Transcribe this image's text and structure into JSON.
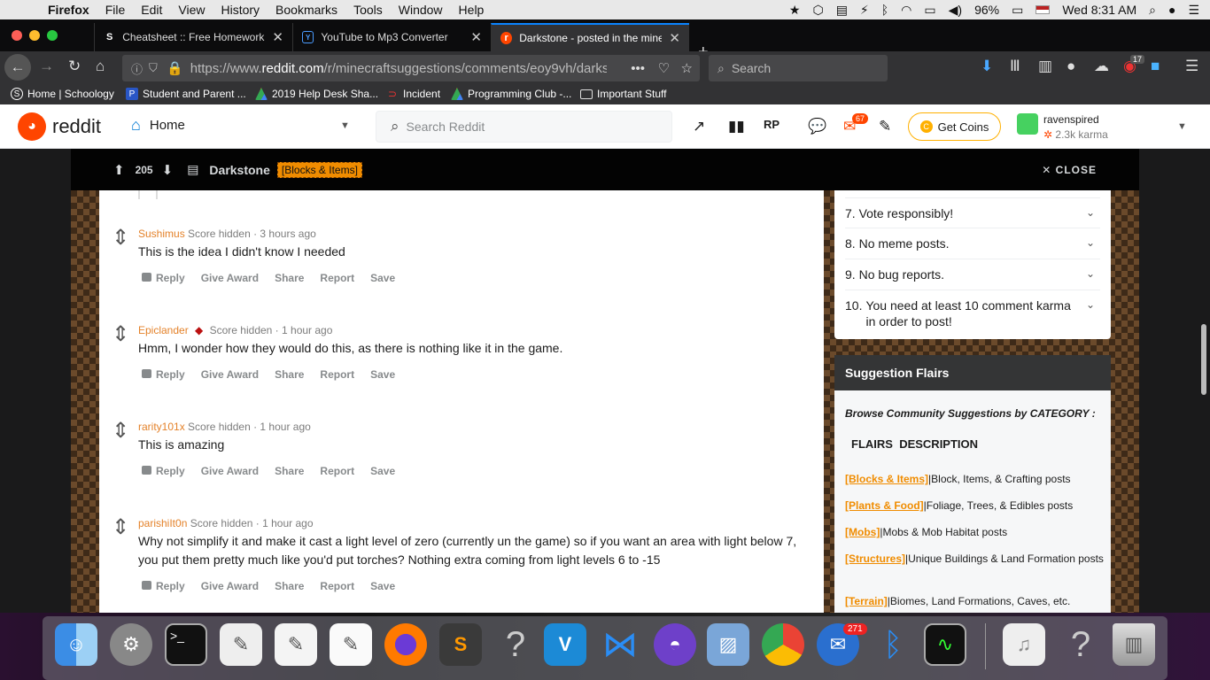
{
  "menubar": {
    "app": "Firefox",
    "items": [
      "File",
      "Edit",
      "View",
      "History",
      "Bookmarks",
      "Tools",
      "Window",
      "Help"
    ],
    "battery": "96%",
    "clock": "Wed 8:31 AM"
  },
  "tabs": [
    {
      "label": "Cheatsheet :: Free Homework H",
      "favicon": "S"
    },
    {
      "label": "YouTube to Mp3 Converter",
      "favicon": "Y"
    },
    {
      "label": "Darkstone - posted in the minec",
      "favicon": "r"
    }
  ],
  "nav": {
    "url_prefix": "https://www.",
    "url_domain": "reddit.com",
    "url_path": "/r/minecraftsuggestions/comments/eoy9vh/darks",
    "search_placeholder": "Search",
    "addon_badge": "17"
  },
  "bookmarks": [
    {
      "label": "Home | Schoology",
      "icon": "S"
    },
    {
      "label": "Student and Parent ...",
      "icon": "P"
    },
    {
      "label": "2019 Help Desk Sha...",
      "icon": "drive"
    },
    {
      "label": "Incident",
      "icon": "sn"
    },
    {
      "label": "Programming Club -...",
      "icon": "drive"
    },
    {
      "label": "Important Stuff",
      "icon": "folder"
    }
  ],
  "reddit_header": {
    "logo_text": "reddit",
    "home_label": "Home",
    "search_placeholder": "Search Reddit",
    "mail_badge": "67",
    "coins_label": "Get Coins",
    "username": "ravenspired",
    "karma": "2.3k karma"
  },
  "post_bar": {
    "score": "205",
    "title": "Darkstone",
    "flair": "[Blocks & Items]",
    "close_label": "CLOSE"
  },
  "comments": [
    {
      "author": "Sushimus",
      "score": "Score hidden",
      "time": "3 hours ago",
      "body": "This is the idea I didn't know I needed"
    },
    {
      "author": "Epiclander",
      "score": "Score hidden",
      "time": "1 hour ago",
      "body": "Hmm, I wonder how they would do this, as there is nothing like it in the game."
    },
    {
      "author": "rarity101x",
      "score": "Score hidden",
      "time": "1 hour ago",
      "body": "This is amazing"
    },
    {
      "author": "parishiIt0n",
      "score": "Score hidden",
      "time": "1 hour ago",
      "body": "Why not simplify it and make it cast a light level of zero (currently un the game) so if you want an area with light below 7, you put them pretty much like you'd put torches? Nothing extra coming from light levels 6 to -15"
    }
  ],
  "comment_actions": [
    "Reply",
    "Give Award",
    "Share",
    "Report",
    "Save"
  ],
  "rules": [
    {
      "num": "7.",
      "text": "Vote responsibly!"
    },
    {
      "num": "8.",
      "text": "No meme posts."
    },
    {
      "num": "9.",
      "text": "No bug reports."
    },
    {
      "num": "10.",
      "text": "You need at least 10 comment karma in order to post!"
    }
  ],
  "flairs": {
    "heading": "Suggestion Flairs",
    "intro": "Browse Community Suggestions by CATEGORY :",
    "col_flairs": "FLAIRS",
    "col_desc": "DESCRIPTION",
    "items": [
      {
        "tag": "[Blocks & Items]",
        "desc": "|Block, Items, & Crafting posts"
      },
      {
        "tag": "[Plants & Food]",
        "desc": "|Foliage, Trees, & Edibles posts"
      },
      {
        "tag": "[Mobs]",
        "desc": "|Mobs & Mob Habitat posts"
      },
      {
        "tag": "[Structures]",
        "desc": "|Unique Buildings & Land Formation posts"
      },
      {
        "tag": "[Terrain]",
        "desc": "|Biomes, Land Formations, Caves, etc."
      }
    ]
  },
  "dock": {
    "mail_badge": "271"
  },
  "colors": {
    "reddit_orange": "#ff4500",
    "flair_orange": "#f08c00",
    "author_orange": "#e4822a"
  }
}
